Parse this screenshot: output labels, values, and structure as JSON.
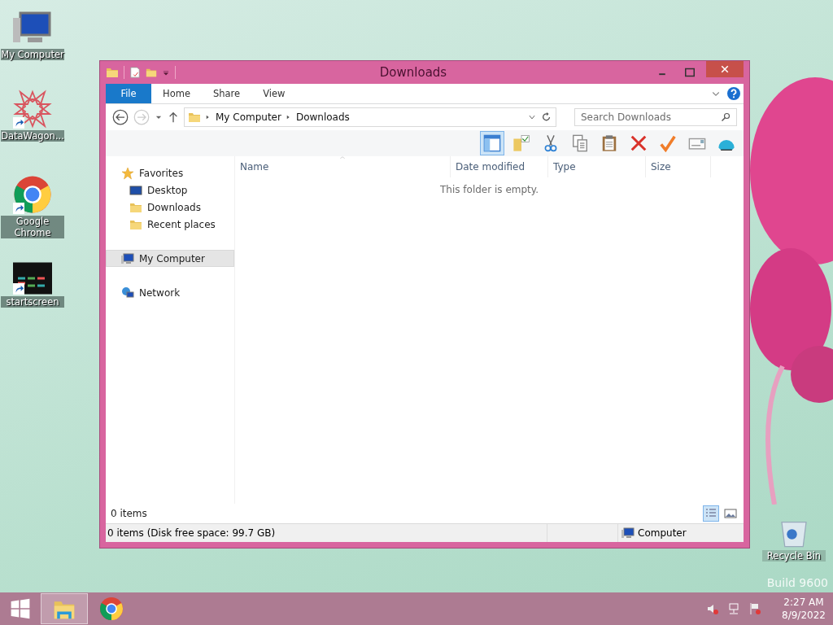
{
  "desktop_icons": [
    {
      "label": "My Computer",
      "kind": "computer",
      "shortcut": false
    },
    {
      "label": "DataWagon...",
      "kind": "star",
      "shortcut": true
    },
    {
      "label": "Google Chrome",
      "kind": "chrome",
      "shortcut": true
    },
    {
      "label": "startscreen",
      "kind": "tiles",
      "shortcut": true
    }
  ],
  "recycle_bin": {
    "label": "Recycle Bin"
  },
  "os_build": "Build 9600",
  "window": {
    "title": "Downloads",
    "ribbon_tabs": [
      {
        "label": "File",
        "kind": "file"
      },
      {
        "label": "Home",
        "kind": "tab"
      },
      {
        "label": "Share",
        "kind": "tab"
      },
      {
        "label": "View",
        "kind": "tab"
      }
    ],
    "breadcrumb": [
      "My Computer",
      "Downloads"
    ],
    "search": {
      "placeholder": "Search Downloads"
    },
    "toolbar": [
      {
        "kind": "preview-pane",
        "on": true
      },
      {
        "kind": "folder-check",
        "on": false
      },
      {
        "kind": "scissors",
        "on": false
      },
      {
        "kind": "copy",
        "on": false
      },
      {
        "kind": "clipboard",
        "on": false
      },
      {
        "kind": "delete",
        "on": false
      },
      {
        "kind": "check",
        "on": false
      },
      {
        "kind": "card",
        "on": false
      },
      {
        "kind": "shell",
        "on": false
      }
    ],
    "nav": [
      {
        "label": "Favorites",
        "kind": "star",
        "selected": false,
        "children": [
          {
            "label": "Desktop",
            "kind": "desktop",
            "selected": false
          },
          {
            "label": "Downloads",
            "kind": "folder",
            "selected": false
          },
          {
            "label": "Recent places",
            "kind": "folder",
            "selected": false
          }
        ]
      },
      {
        "label": "My Computer",
        "kind": "computer",
        "selected": true
      },
      {
        "label": "Network",
        "kind": "network",
        "selected": false
      }
    ],
    "columns": [
      {
        "label": "Name",
        "sorted": true
      },
      {
        "label": "Date modified",
        "sorted": false
      },
      {
        "label": "Type",
        "sorted": false
      },
      {
        "label": "Size",
        "sorted": false
      }
    ],
    "empty_message": "This folder is empty.",
    "item_count": "0 items",
    "views": [
      {
        "kind": "details",
        "selected": true
      },
      {
        "kind": "large-icons",
        "selected": false
      }
    ],
    "status_bar": {
      "left": "0 items (Disk free space: 99.7 GB)",
      "right": "Computer"
    }
  },
  "taskbar": {
    "apps": [
      {
        "kind": "explorer",
        "selected": true
      },
      {
        "kind": "chrome",
        "selected": false
      }
    ],
    "tray": [
      {
        "kind": "sound-muted"
      },
      {
        "kind": "network"
      },
      {
        "kind": "flag"
      }
    ],
    "time": "2:27 AM",
    "date": "8/9/2022"
  }
}
